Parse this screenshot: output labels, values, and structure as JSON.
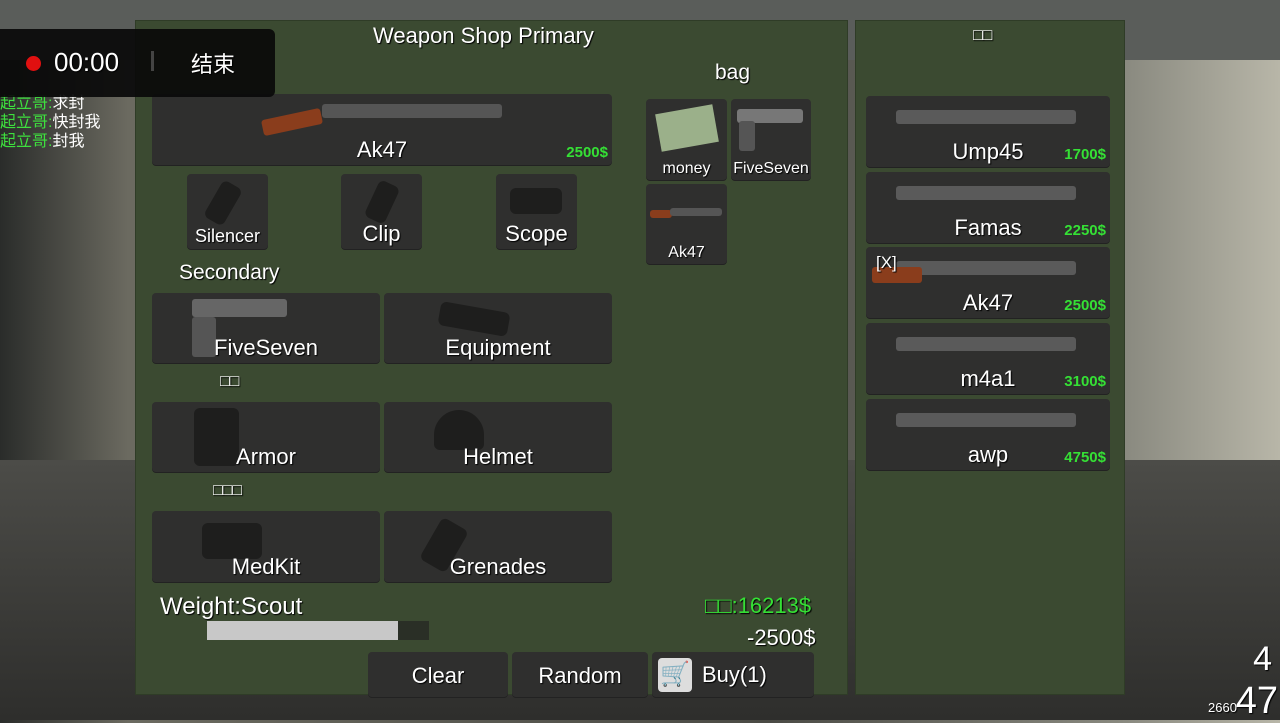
{
  "recorder": {
    "time": "00:00",
    "end_label": "结束",
    "dot_color": "#e01010"
  },
  "chat": [
    {
      "name": "起立哥:",
      "msg": "求封"
    },
    {
      "name": "起立哥:",
      "msg": "快封我"
    },
    {
      "name": "起立哥:",
      "msg": "封我"
    }
  ],
  "shop": {
    "title": "Weapon Shop Primary",
    "primary": {
      "name": "Ak47",
      "price": "2500$"
    },
    "attachments": [
      "Silencer",
      "Clip",
      "Scope"
    ],
    "secondary_label": "Secondary",
    "secondary": [
      "FiveSeven",
      "Equipment"
    ],
    "armor_section_label": "□□",
    "armor": [
      "Armor",
      "Helmet"
    ],
    "medical_section_label": "□□□",
    "medical": [
      "MedKit",
      "Grenades"
    ],
    "weight_label": "Weight:Scout",
    "weight_fraction": 0.86,
    "money_label": "□□:16213$",
    "cost": "-2500$",
    "buttons": {
      "clear": "Clear",
      "random": "Random",
      "buy": "Buy(1)"
    }
  },
  "bag": {
    "label": "bag",
    "items": [
      "money",
      "FiveSeven",
      "Ak47"
    ]
  },
  "list": {
    "header": "□□",
    "items": [
      {
        "name": "Ump45",
        "price": "1700$",
        "tag": ""
      },
      {
        "name": "Famas",
        "price": "2250$",
        "tag": ""
      },
      {
        "name": "Ak47",
        "price": "2500$",
        "tag": "[X]"
      },
      {
        "name": "m4a1",
        "price": "3100$",
        "tag": ""
      },
      {
        "name": "awp",
        "price": "4750$",
        "tag": ""
      }
    ]
  },
  "hud": {
    "top_right": "4",
    "ammo_reserve": "2660",
    "ammo": "47"
  },
  "colors": {
    "panel": "#3b4a31",
    "button": "#2f2f2e",
    "price": "#35e035"
  }
}
